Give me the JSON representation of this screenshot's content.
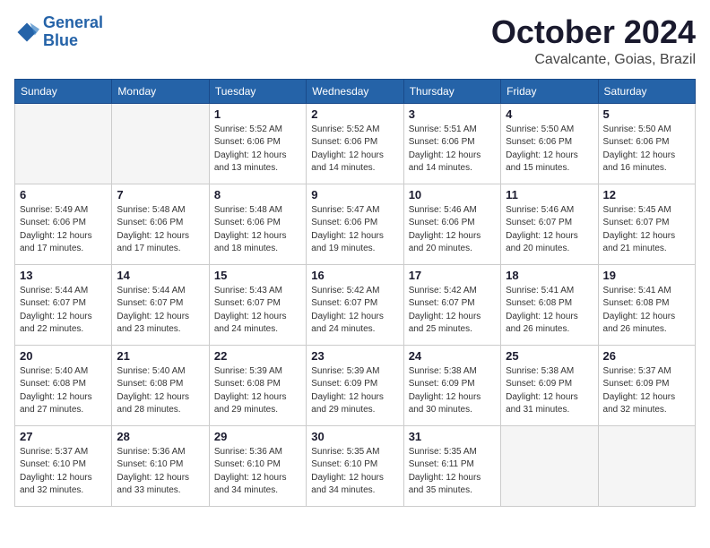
{
  "logo": {
    "text_general": "General",
    "text_blue": "Blue"
  },
  "header": {
    "month": "October 2024",
    "location": "Cavalcante, Goias, Brazil"
  },
  "weekdays": [
    "Sunday",
    "Monday",
    "Tuesday",
    "Wednesday",
    "Thursday",
    "Friday",
    "Saturday"
  ],
  "weeks": [
    [
      {
        "day": "",
        "info": ""
      },
      {
        "day": "",
        "info": ""
      },
      {
        "day": "1",
        "info": "Sunrise: 5:52 AM\nSunset: 6:06 PM\nDaylight: 12 hours\nand 13 minutes."
      },
      {
        "day": "2",
        "info": "Sunrise: 5:52 AM\nSunset: 6:06 PM\nDaylight: 12 hours\nand 14 minutes."
      },
      {
        "day": "3",
        "info": "Sunrise: 5:51 AM\nSunset: 6:06 PM\nDaylight: 12 hours\nand 14 minutes."
      },
      {
        "day": "4",
        "info": "Sunrise: 5:50 AM\nSunset: 6:06 PM\nDaylight: 12 hours\nand 15 minutes."
      },
      {
        "day": "5",
        "info": "Sunrise: 5:50 AM\nSunset: 6:06 PM\nDaylight: 12 hours\nand 16 minutes."
      }
    ],
    [
      {
        "day": "6",
        "info": "Sunrise: 5:49 AM\nSunset: 6:06 PM\nDaylight: 12 hours\nand 17 minutes."
      },
      {
        "day": "7",
        "info": "Sunrise: 5:48 AM\nSunset: 6:06 PM\nDaylight: 12 hours\nand 17 minutes."
      },
      {
        "day": "8",
        "info": "Sunrise: 5:48 AM\nSunset: 6:06 PM\nDaylight: 12 hours\nand 18 minutes."
      },
      {
        "day": "9",
        "info": "Sunrise: 5:47 AM\nSunset: 6:06 PM\nDaylight: 12 hours\nand 19 minutes."
      },
      {
        "day": "10",
        "info": "Sunrise: 5:46 AM\nSunset: 6:06 PM\nDaylight: 12 hours\nand 20 minutes."
      },
      {
        "day": "11",
        "info": "Sunrise: 5:46 AM\nSunset: 6:07 PM\nDaylight: 12 hours\nand 20 minutes."
      },
      {
        "day": "12",
        "info": "Sunrise: 5:45 AM\nSunset: 6:07 PM\nDaylight: 12 hours\nand 21 minutes."
      }
    ],
    [
      {
        "day": "13",
        "info": "Sunrise: 5:44 AM\nSunset: 6:07 PM\nDaylight: 12 hours\nand 22 minutes."
      },
      {
        "day": "14",
        "info": "Sunrise: 5:44 AM\nSunset: 6:07 PM\nDaylight: 12 hours\nand 23 minutes."
      },
      {
        "day": "15",
        "info": "Sunrise: 5:43 AM\nSunset: 6:07 PM\nDaylight: 12 hours\nand 24 minutes."
      },
      {
        "day": "16",
        "info": "Sunrise: 5:42 AM\nSunset: 6:07 PM\nDaylight: 12 hours\nand 24 minutes."
      },
      {
        "day": "17",
        "info": "Sunrise: 5:42 AM\nSunset: 6:07 PM\nDaylight: 12 hours\nand 25 minutes."
      },
      {
        "day": "18",
        "info": "Sunrise: 5:41 AM\nSunset: 6:08 PM\nDaylight: 12 hours\nand 26 minutes."
      },
      {
        "day": "19",
        "info": "Sunrise: 5:41 AM\nSunset: 6:08 PM\nDaylight: 12 hours\nand 26 minutes."
      }
    ],
    [
      {
        "day": "20",
        "info": "Sunrise: 5:40 AM\nSunset: 6:08 PM\nDaylight: 12 hours\nand 27 minutes."
      },
      {
        "day": "21",
        "info": "Sunrise: 5:40 AM\nSunset: 6:08 PM\nDaylight: 12 hours\nand 28 minutes."
      },
      {
        "day": "22",
        "info": "Sunrise: 5:39 AM\nSunset: 6:08 PM\nDaylight: 12 hours\nand 29 minutes."
      },
      {
        "day": "23",
        "info": "Sunrise: 5:39 AM\nSunset: 6:09 PM\nDaylight: 12 hours\nand 29 minutes."
      },
      {
        "day": "24",
        "info": "Sunrise: 5:38 AM\nSunset: 6:09 PM\nDaylight: 12 hours\nand 30 minutes."
      },
      {
        "day": "25",
        "info": "Sunrise: 5:38 AM\nSunset: 6:09 PM\nDaylight: 12 hours\nand 31 minutes."
      },
      {
        "day": "26",
        "info": "Sunrise: 5:37 AM\nSunset: 6:09 PM\nDaylight: 12 hours\nand 32 minutes."
      }
    ],
    [
      {
        "day": "27",
        "info": "Sunrise: 5:37 AM\nSunset: 6:10 PM\nDaylight: 12 hours\nand 32 minutes."
      },
      {
        "day": "28",
        "info": "Sunrise: 5:36 AM\nSunset: 6:10 PM\nDaylight: 12 hours\nand 33 minutes."
      },
      {
        "day": "29",
        "info": "Sunrise: 5:36 AM\nSunset: 6:10 PM\nDaylight: 12 hours\nand 34 minutes."
      },
      {
        "day": "30",
        "info": "Sunrise: 5:35 AM\nSunset: 6:10 PM\nDaylight: 12 hours\nand 34 minutes."
      },
      {
        "day": "31",
        "info": "Sunrise: 5:35 AM\nSunset: 6:11 PM\nDaylight: 12 hours\nand 35 minutes."
      },
      {
        "day": "",
        "info": ""
      },
      {
        "day": "",
        "info": ""
      }
    ]
  ]
}
